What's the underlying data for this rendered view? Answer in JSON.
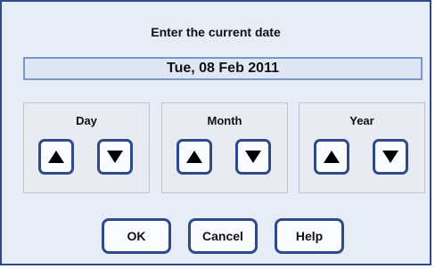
{
  "dialog": {
    "title": "Enter the current date",
    "date_value": "Tue, 08 Feb 2011"
  },
  "groups": {
    "day": {
      "label": "Day"
    },
    "month": {
      "label": "Month"
    },
    "year": {
      "label": "Year"
    }
  },
  "icons": {
    "increment": "triangle-up-icon",
    "decrement": "triangle-down-icon"
  },
  "buttons": {
    "ok": "OK",
    "cancel": "Cancel",
    "help": "Help"
  },
  "colors": {
    "border": "#2f4a8a",
    "background": "#e6edf7",
    "display_border": "#7e96c6"
  }
}
